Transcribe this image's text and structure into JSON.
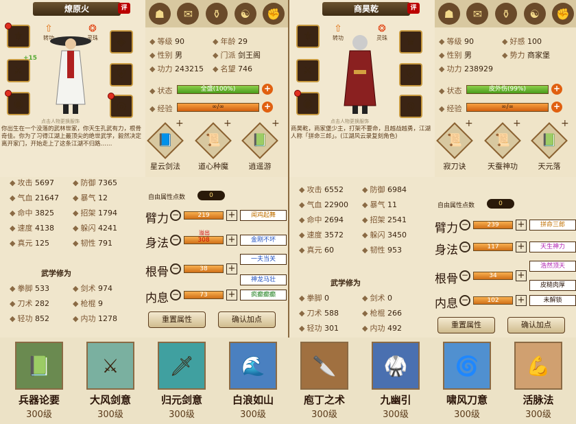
{
  "left": {
    "name": "燎原火",
    "ping": "评",
    "left_top_label": "装备",
    "mid_labels": [
      "转功",
      "灵珠"
    ],
    "figure_tip": "点击人物更换服饰",
    "desc": "你出生在一个没落的武林世家，你天生孔武有力，根骨奇佳。你为了习得江湖上最顶尖的绝世武学，毅然决定离开家门，开始走上了这条江湖不归路……",
    "slot_plus": "+15",
    "stats": [
      [
        "等级",
        "90"
      ],
      [
        "年龄",
        "29"
      ],
      [
        "性别",
        "男"
      ],
      [
        "门派",
        "剑王阁"
      ],
      [
        "功力",
        "243215"
      ],
      [
        "名望",
        "746"
      ]
    ],
    "status_label": "状态",
    "status": "全盛(100%)",
    "exp_label": "经验",
    "exp": "∞/∞",
    "skills": [
      "星云剑法",
      "道心种魔",
      "逍遥游"
    ],
    "combat": [
      [
        "攻击",
        "5697"
      ],
      [
        "防御",
        "7365"
      ],
      [
        "气血",
        "21647"
      ],
      [
        "暴气",
        "12"
      ],
      [
        "命中",
        "3825"
      ],
      [
        "招架",
        "1794"
      ],
      [
        "速度",
        "4138"
      ],
      [
        "躲闪",
        "4241"
      ],
      [
        "真元",
        "125"
      ],
      [
        "韧性",
        "791"
      ]
    ],
    "wuxue_title": "武学修为",
    "wuxue": [
      [
        "拳脚",
        "533"
      ],
      [
        "剑术",
        "974"
      ],
      [
        "刀术",
        "282"
      ],
      [
        "枪棍",
        "9"
      ],
      [
        "轻功",
        "852"
      ],
      [
        "内功",
        "1278"
      ]
    ],
    "free_label": "自由属性点数",
    "free": "0",
    "attrs": [
      [
        "臂力",
        "219",
        "闻鸡起舞"
      ],
      [
        "身法",
        "308",
        "金刚不坏"
      ],
      [
        "根骨",
        "38",
        "一夫当关"
      ],
      [
        "内息",
        "73",
        "神龙马壮"
      ]
    ],
    "extra_tag": "疯癫癫癫",
    "overflow": "溢出",
    "reset": "重置属性",
    "confirm": "确认加点"
  },
  "right": {
    "name": "商昊乾",
    "ping": "评",
    "mid_labels": [
      "转功",
      "灵珠"
    ],
    "figure_tip": "点击人物更换服饰",
    "desc": "商昊乾，商家堡少主，打架不要命，且越战越勇，江湖人称「拼命三郎」。(江湖风云录复刻角色)",
    "stats": [
      [
        "等级",
        "90"
      ],
      [
        "好感",
        "100"
      ],
      [
        "性别",
        "男"
      ],
      [
        "势力",
        "商家堡"
      ],
      [
        "功力",
        "238929"
      ]
    ],
    "status_label": "状态",
    "status": "皮外伤(99%)",
    "exp_label": "经验",
    "exp": "∞/∞",
    "skills": [
      "寂刀诀",
      "天蚕神功",
      "天元落"
    ],
    "combat": [
      [
        "攻击",
        "6552"
      ],
      [
        "防御",
        "6984"
      ],
      [
        "气血",
        "22900"
      ],
      [
        "暴气",
        "11"
      ],
      [
        "命中",
        "2694"
      ],
      [
        "招架",
        "2541"
      ],
      [
        "速度",
        "3572"
      ],
      [
        "躲闪",
        "3450"
      ],
      [
        "真元",
        "60"
      ],
      [
        "韧性",
        "953"
      ]
    ],
    "wuxue_title": "武学修为",
    "wuxue": [
      [
        "拳脚",
        "0"
      ],
      [
        "剑术",
        "0"
      ],
      [
        "刀术",
        "588"
      ],
      [
        "枪棍",
        "266"
      ],
      [
        "轻功",
        "301"
      ],
      [
        "内功",
        "492"
      ]
    ],
    "free_label": "自由属性点数",
    "free": "0",
    "attrs": [
      [
        "臂力",
        "239",
        "拼命三郎"
      ],
      [
        "身法",
        "117",
        "天生神力"
      ],
      [
        "根骨",
        "34",
        "浩然顶天"
      ],
      [
        "内息",
        "102",
        "皮糙肉厚"
      ]
    ],
    "extra_tag": "未解锁",
    "reset": "重置属性",
    "confirm": "确认加点"
  },
  "bottom": [
    [
      "兵器论要",
      "300级"
    ],
    [
      "大风剑意",
      "300级"
    ],
    [
      "归元剑意",
      "300级"
    ],
    [
      "白浪如山",
      "300级"
    ],
    [
      "庖丁之术",
      "300级"
    ],
    [
      "九幽引",
      "300级"
    ],
    [
      "啸风刀意",
      "300级"
    ],
    [
      "活脉法",
      "300级"
    ]
  ]
}
